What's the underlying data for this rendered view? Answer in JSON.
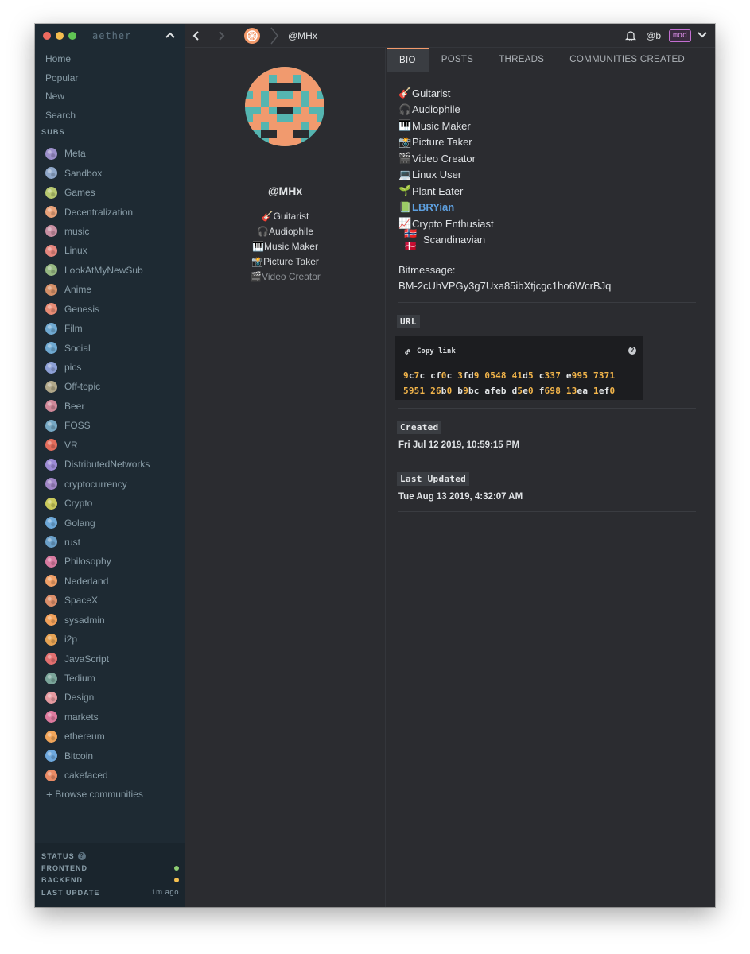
{
  "app": {
    "name": "aether",
    "window_dots": [
      "#ee6a5f",
      "#f5bd4f",
      "#61c554"
    ]
  },
  "sidebar": {
    "nav": [
      "Home",
      "Popular",
      "New",
      "Search"
    ],
    "subs_heading": "SUBS",
    "subs": [
      {
        "label": "Meta",
        "color": "#9b8fc9"
      },
      {
        "label": "Sandbox",
        "color": "#8fa7c9"
      },
      {
        "label": "Games",
        "color": "#b7c870"
      },
      {
        "label": "Decentralization",
        "color": "#e8a27a"
      },
      {
        "label": "music",
        "color": "#c88fa2"
      },
      {
        "label": "Linux",
        "color": "#e5867e"
      },
      {
        "label": "LookAtMyNewSub",
        "color": "#96b882"
      },
      {
        "label": "Anime",
        "color": "#d59068"
      },
      {
        "label": "Genesis",
        "color": "#e88c75"
      },
      {
        "label": "Film",
        "color": "#6fa9d1"
      },
      {
        "label": "Social",
        "color": "#6fa9d1"
      },
      {
        "label": "pics",
        "color": "#8da0d6"
      },
      {
        "label": "Off-topic",
        "color": "#b1a88a"
      },
      {
        "label": "Beer",
        "color": "#d08899"
      },
      {
        "label": "FOSS",
        "color": "#76a8c4"
      },
      {
        "label": "VR",
        "color": "#e36d5c"
      },
      {
        "label": "DistributedNetworks",
        "color": "#9c8bd4"
      },
      {
        "label": "cryptocurrency",
        "color": "#a087c6"
      },
      {
        "label": "Crypto",
        "color": "#c9c95c"
      },
      {
        "label": "Golang",
        "color": "#6da8d8"
      },
      {
        "label": "rust",
        "color": "#6a9fc8"
      },
      {
        "label": "Philosophy",
        "color": "#d77aa0"
      },
      {
        "label": "Nederland",
        "color": "#f0a067"
      },
      {
        "label": "SpaceX",
        "color": "#dc8f6a"
      },
      {
        "label": "sysadmin",
        "color": "#f2a15a"
      },
      {
        "label": "i2p",
        "color": "#e6a354"
      },
      {
        "label": "JavaScript",
        "color": "#e27070"
      },
      {
        "label": "Tedium",
        "color": "#7aa59a"
      },
      {
        "label": "Design",
        "color": "#e59aa0"
      },
      {
        "label": "markets",
        "color": "#dd7a9e"
      },
      {
        "label": "ethereum",
        "color": "#f0a55a"
      },
      {
        "label": "Bitcoin",
        "color": "#6ea8dd"
      },
      {
        "label": "cakefaced",
        "color": "#ea8b65"
      }
    ],
    "browse": "Browse communities",
    "status": {
      "heading": "STATUS",
      "frontend": "FRONTEND",
      "frontend_color": "#8fcf73",
      "backend": "BACKEND",
      "backend_color": "#f5c04f",
      "last_update": "LAST UPDATE",
      "last_update_value": "1m ago"
    }
  },
  "topbar": {
    "title": "@MHx",
    "user": "@b",
    "badge": "mod"
  },
  "profile": {
    "name": "@MHx",
    "bio_preview": [
      {
        "emoji": "🎸",
        "text": "Guitarist"
      },
      {
        "emoji": "🎧",
        "text": "Audiophile"
      },
      {
        "emoji": "🎹",
        "text": "Music Maker"
      },
      {
        "emoji": "📸",
        "text": "Picture Taker"
      },
      {
        "emoji": "🎬",
        "text": "Video Creator"
      }
    ]
  },
  "tabs": [
    "BIO",
    "POSTS",
    "THREADS",
    "COMMUNITIES CREATED"
  ],
  "bio": {
    "lines": [
      {
        "emoji": "🎸",
        "text": "Guitarist"
      },
      {
        "emoji": "🎧",
        "text": "Audiophile"
      },
      {
        "emoji": "🎹",
        "text": "Music Maker"
      },
      {
        "emoji": "📸",
        "text": "Picture Taker"
      },
      {
        "emoji": "🎬",
        "text": "Video Creator"
      },
      {
        "emoji": "💻",
        "text": "Linux User"
      },
      {
        "emoji": "🌱",
        "text": "Plant Eater"
      },
      {
        "emoji": "📗",
        "text": "LBRYian"
      },
      {
        "emoji": "📈",
        "text": "Crypto Enthusiast"
      },
      {
        "emoji": "🇳🇴🇩🇰",
        "text": "Scandinavian"
      }
    ],
    "bitmessage_label": "Bitmessage:",
    "bitmessage_value": "BM-2cUhVPGy3g7Uxa85ibXtjcgc1ho6WcrBJq"
  },
  "url": {
    "label": "URL",
    "copy": "Copy link",
    "line1": [
      "9c7c",
      "cf0c",
      "3fd9",
      "0548",
      "41d5",
      "c337",
      "e995",
      "7371"
    ],
    "line2": [
      "5951",
      "26b0",
      "b9bc",
      "afeb",
      "d5e0",
      "f698",
      "13ea",
      "1ef0"
    ]
  },
  "created": {
    "label": "Created",
    "value": "Fri Jul 12 2019, 10:59:15 PM"
  },
  "updated": {
    "label": "Last Updated",
    "value": "Tue Aug 13 2019, 4:32:07 AM"
  }
}
